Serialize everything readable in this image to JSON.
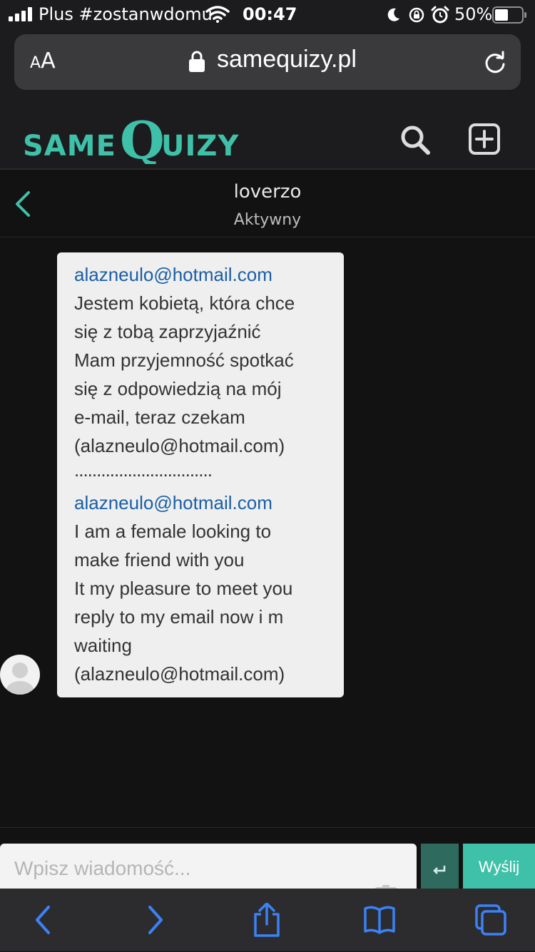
{
  "status_bar": {
    "carrier": "Plus #zostanwdomu",
    "time": "00:47",
    "battery_percent": "50%",
    "battery_level": 0.5,
    "icons": [
      "signal-icon",
      "wifi-icon",
      "moon-icon",
      "rotation-lock-icon",
      "alarm-icon",
      "battery-icon"
    ]
  },
  "browser": {
    "text_size_label": "AA",
    "domain": "samequizy.pl"
  },
  "site": {
    "logo_text": "SAMEQUIZY",
    "accent_color": "#3fc0a8"
  },
  "chat": {
    "contact_name": "loverzo",
    "contact_status": "Aktywny",
    "message_lines": [
      "alazneulo@hotmail.com",
      "Jestem kobietą, która chce",
      "się z tobą zaprzyjaźnić",
      "Mam przyjemność spotkać",
      "się z odpowiedzią na mój",
      "e-mail, teraz czekam",
      "(alazneulo@hotmail.com)",
      "...............................",
      "alazneulo@hotmail.com",
      "I am a female looking to",
      "make friend with you",
      "It my pleasure to meet you",
      "reply to my email now i m",
      "waiting",
      "(alazneulo@hotmail.com)"
    ]
  },
  "composer": {
    "placeholder": "Wpisz wiadomość...",
    "send_label": "Wyślij",
    "enter_symbol": "↵"
  }
}
